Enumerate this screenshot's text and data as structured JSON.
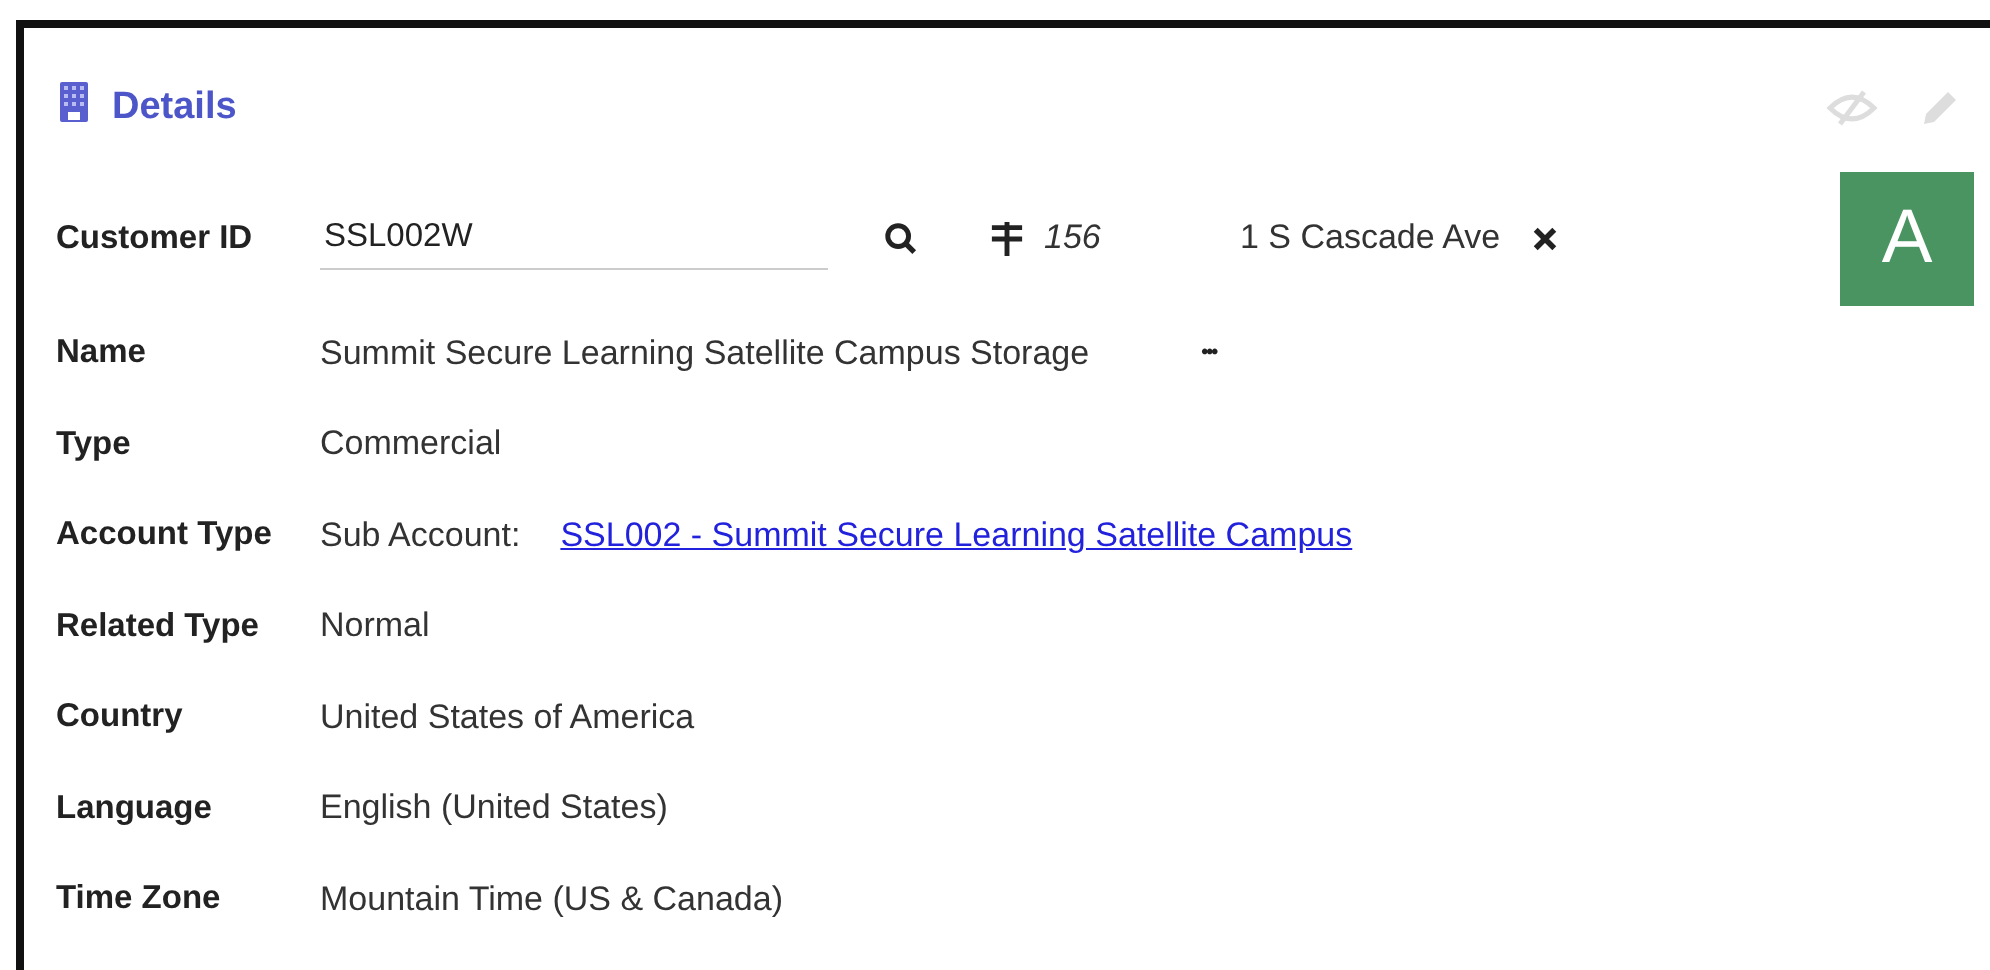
{
  "panel": {
    "title": "Details"
  },
  "customer_id": {
    "label": "Customer ID",
    "value": "SSL002W",
    "number": "156",
    "address": "1 S Cascade Ave",
    "avatar": "A"
  },
  "fields": [
    {
      "kind": "text",
      "label": "Name",
      "value": "Summit Secure Learning Satellite Campus Storage",
      "more": "•••"
    },
    {
      "kind": "text",
      "label": "Type",
      "value": "Commercial"
    },
    {
      "kind": "link",
      "label": "Account Type",
      "value": "Sub Account:",
      "link": "SSL002 - Summit Secure Learning Satellite Campus"
    },
    {
      "kind": "text",
      "label": "Related Type",
      "value": "Normal"
    },
    {
      "kind": "text",
      "label": "Country",
      "value": "United States of America"
    },
    {
      "kind": "text",
      "label": "Language",
      "value": "English (United States)"
    },
    {
      "kind": "text",
      "label": "Time Zone",
      "value": "Mountain Time (US & Canada)"
    }
  ]
}
